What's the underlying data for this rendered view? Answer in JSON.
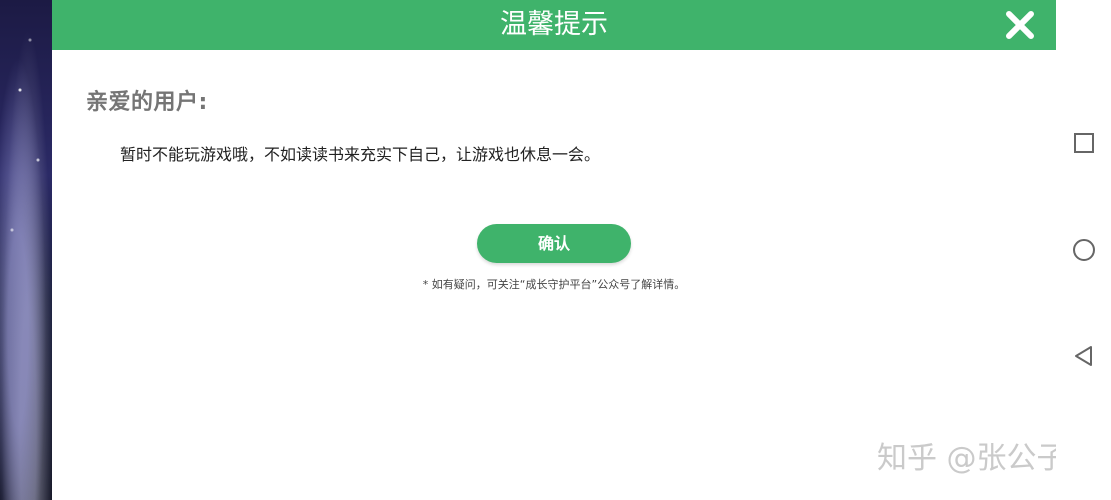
{
  "dialog": {
    "title": "温馨提示",
    "greeting": "亲爱的用户:",
    "message": "暂时不能玩游戏哦，不如读读书来充实下自己，让游戏也休息一会。",
    "confirm_label": "确认",
    "footnote": "* 如有疑问，可关注“成长守护平台”公众号了解详情。",
    "close_icon": "close-icon"
  },
  "watermark": {
    "text": "知乎 @张公子"
  },
  "nav_bar": {
    "icons": [
      "recent-apps-icon",
      "home-icon",
      "back-icon"
    ]
  },
  "colors": {
    "accent": "#3fb36b",
    "header_text": "#ffffff",
    "greeting": "#757575"
  }
}
